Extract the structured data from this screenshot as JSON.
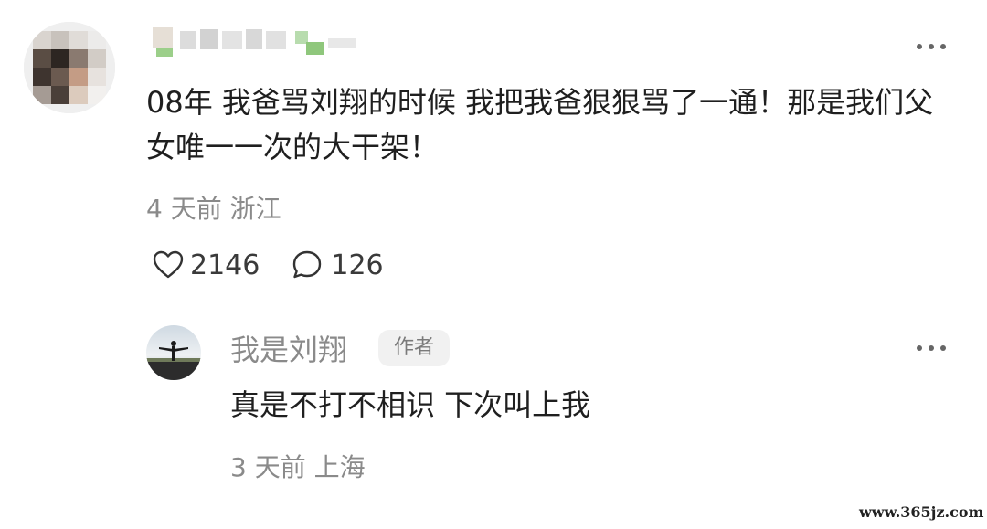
{
  "top_comment": {
    "text": "08年 我爸骂刘翔的时候 我把我爸狠狠骂了一通！那是我们父女唯一一次的大干架！",
    "time_ago": "4 天前",
    "location": "浙江",
    "like_count": "2146",
    "reply_count": "126",
    "more_icon": "more-horizontal-icon"
  },
  "reply": {
    "username": "我是刘翔",
    "badge": "作者",
    "text": "真是不打不相识 下次叫上我",
    "time_ago": "3 天前",
    "location": "上海",
    "more_icon": "more-horizontal-icon"
  },
  "watermark": "www.365jz.com",
  "colors": {
    "text_primary": "#1f1f1f",
    "text_secondary": "#8a8a8a",
    "badge_bg": "#f1f1f1"
  }
}
